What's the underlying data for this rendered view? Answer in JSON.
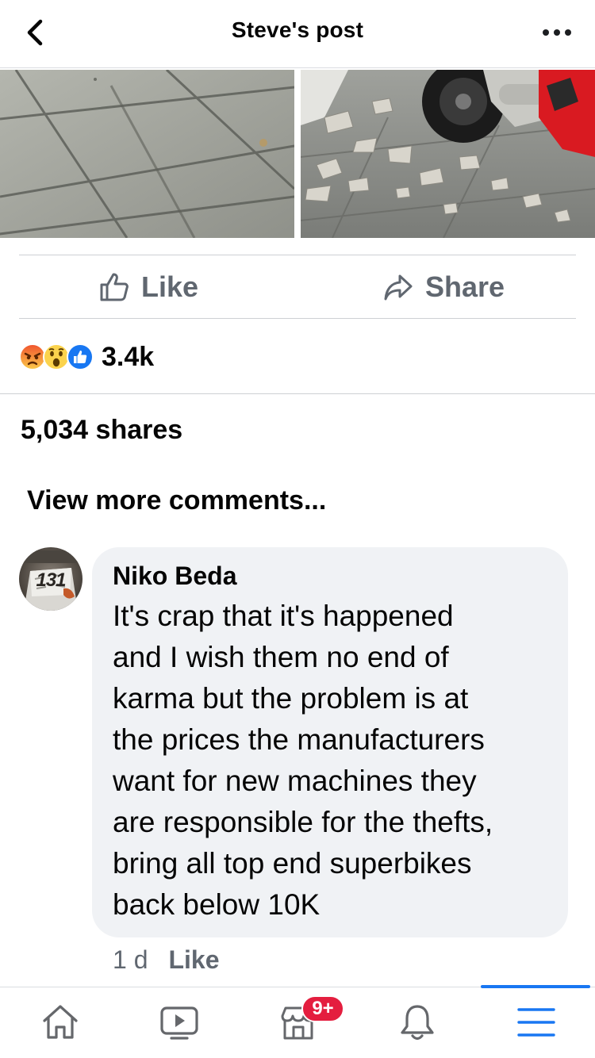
{
  "header": {
    "title": "Steve's post",
    "back_icon": "chevron-left-icon",
    "more_icon": "more-horizontal-icon"
  },
  "photos": [
    {
      "name": "floor-tiles-photo"
    },
    {
      "name": "broken-tiles-motorcycle-photo"
    }
  ],
  "actions": {
    "like_label": "Like",
    "share_label": "Share"
  },
  "reactions": {
    "icons": [
      "angry-reaction-icon",
      "wow-reaction-icon",
      "like-reaction-icon"
    ],
    "count": "3.4k"
  },
  "shares": {
    "text": "5,034 shares"
  },
  "comments": {
    "view_more": "View more comments...",
    "items": [
      {
        "author": "Niko Beda",
        "avatar_text": "131",
        "text": "It's crap that it's happened\nand I wish them no end of\nkarma but the problem is at\nthe prices the manufacturers\nwant for new machines they\nare responsible for the thefts,\nbring all top end superbikes\nback below 10K",
        "time": "1 d",
        "like_label": "Like"
      }
    ]
  },
  "tabbar": {
    "tabs": [
      "home-icon",
      "watch-icon",
      "marketplace-icon",
      "notifications-icon",
      "menu-icon"
    ],
    "marketplace_badge": "9+",
    "active_tab": "menu-icon"
  },
  "colors": {
    "accent": "#1877f2",
    "badge": "#e41e3f",
    "muted_text": "#606770",
    "bubble_bg": "#f0f2f5"
  }
}
